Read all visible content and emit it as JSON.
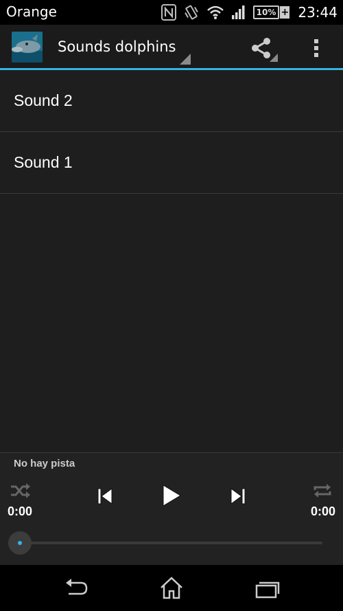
{
  "status_bar": {
    "carrier": "Orange",
    "battery": "10%",
    "battery_charging": "+",
    "time": "23:44",
    "icons": [
      "nfc-icon",
      "vibrate-icon",
      "wifi-icon",
      "signal-icon",
      "battery-icon"
    ]
  },
  "action_bar": {
    "title": "Sounds dolphins",
    "app_icon": "dolphin-app-icon",
    "actions": [
      "share-icon",
      "overflow-menu-icon"
    ],
    "accent_color": "#33b5e5"
  },
  "list": {
    "items": [
      {
        "label": "Sound 2"
      },
      {
        "label": "Sound 1"
      }
    ]
  },
  "player": {
    "track": "No hay pista",
    "elapsed": "0:00",
    "duration": "0:00",
    "progress": 0,
    "controls": [
      "shuffle-icon",
      "previous-icon",
      "play-icon",
      "next-icon",
      "repeat-icon"
    ]
  },
  "nav_bar": {
    "buttons": [
      "back-icon",
      "home-icon",
      "recent-apps-icon"
    ]
  }
}
